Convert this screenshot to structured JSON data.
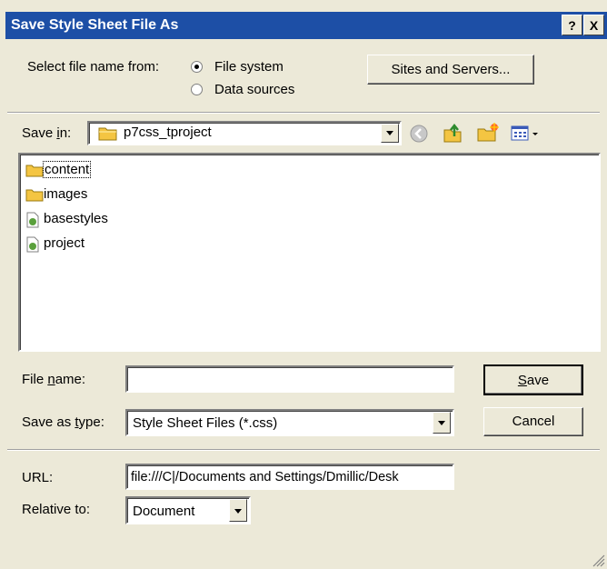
{
  "window": {
    "title": "Save Style Sheet File As",
    "help_button": "?",
    "close_button": "X"
  },
  "select_from": {
    "label": "Select file name from:",
    "options": [
      {
        "label": "File system",
        "selected": true
      },
      {
        "label": "Data sources",
        "selected": false
      }
    ],
    "sites_button": "Sites and Servers..."
  },
  "save_in": {
    "label_pre": "Save ",
    "label_u": "i",
    "label_post": "n:",
    "folder": "p7css_tproject"
  },
  "toolbar_icons": [
    "back-icon",
    "up-folder-icon",
    "new-folder-icon",
    "view-menu-icon"
  ],
  "files": [
    {
      "name": "content",
      "icon": "folder-icon",
      "focused": true
    },
    {
      "name": "images",
      "icon": "folder-icon",
      "focused": false
    },
    {
      "name": "basestyles",
      "icon": "css-file-icon",
      "focused": false
    },
    {
      "name": "project",
      "icon": "css-file-icon",
      "focused": false
    }
  ],
  "file_name": {
    "label_pre": "File ",
    "label_u": "n",
    "label_post": "ame:",
    "value": ""
  },
  "save_as_type": {
    "label_pre": "Save as ",
    "label_u": "t",
    "label_post": "ype:",
    "value": "Style Sheet Files (*.css)"
  },
  "buttons": {
    "save_u": "S",
    "save_rest": "ave",
    "cancel": "Cancel"
  },
  "url": {
    "label": "URL:",
    "value": "file:///C|/Documents and Settings/Dmillic/Desk"
  },
  "relative_to": {
    "label": "Relative to:",
    "value": "Document"
  },
  "colors": {
    "title_bar": "#1d4fa6",
    "dialog_bg": "#ece9d8",
    "folder": "#f4c542"
  }
}
